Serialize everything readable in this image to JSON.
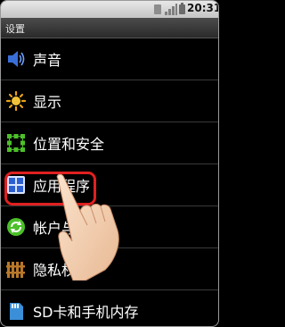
{
  "status_bar": {
    "time": "20:31"
  },
  "title_bar": {
    "title": "设置"
  },
  "settings_items": [
    {
      "label": "声音",
      "icon": "speaker-icon"
    },
    {
      "label": "显示",
      "icon": "brightness-icon"
    },
    {
      "label": "位置和安全",
      "icon": "location-security-icon"
    },
    {
      "label": "应用程序",
      "icon": "applications-icon"
    },
    {
      "label": "帐户与同步",
      "icon": "sync-icon"
    },
    {
      "label": "隐私权",
      "icon": "privacy-icon"
    },
    {
      "label": "SD卡和手机内存",
      "icon": "sd-card-icon"
    }
  ],
  "highlighted_item": "应用程序",
  "colors": {
    "highlight": "#e02020",
    "accent_blue": "#3a6fd8",
    "accent_green": "#4cbf2a",
    "accent_orange": "#e8a21a"
  }
}
